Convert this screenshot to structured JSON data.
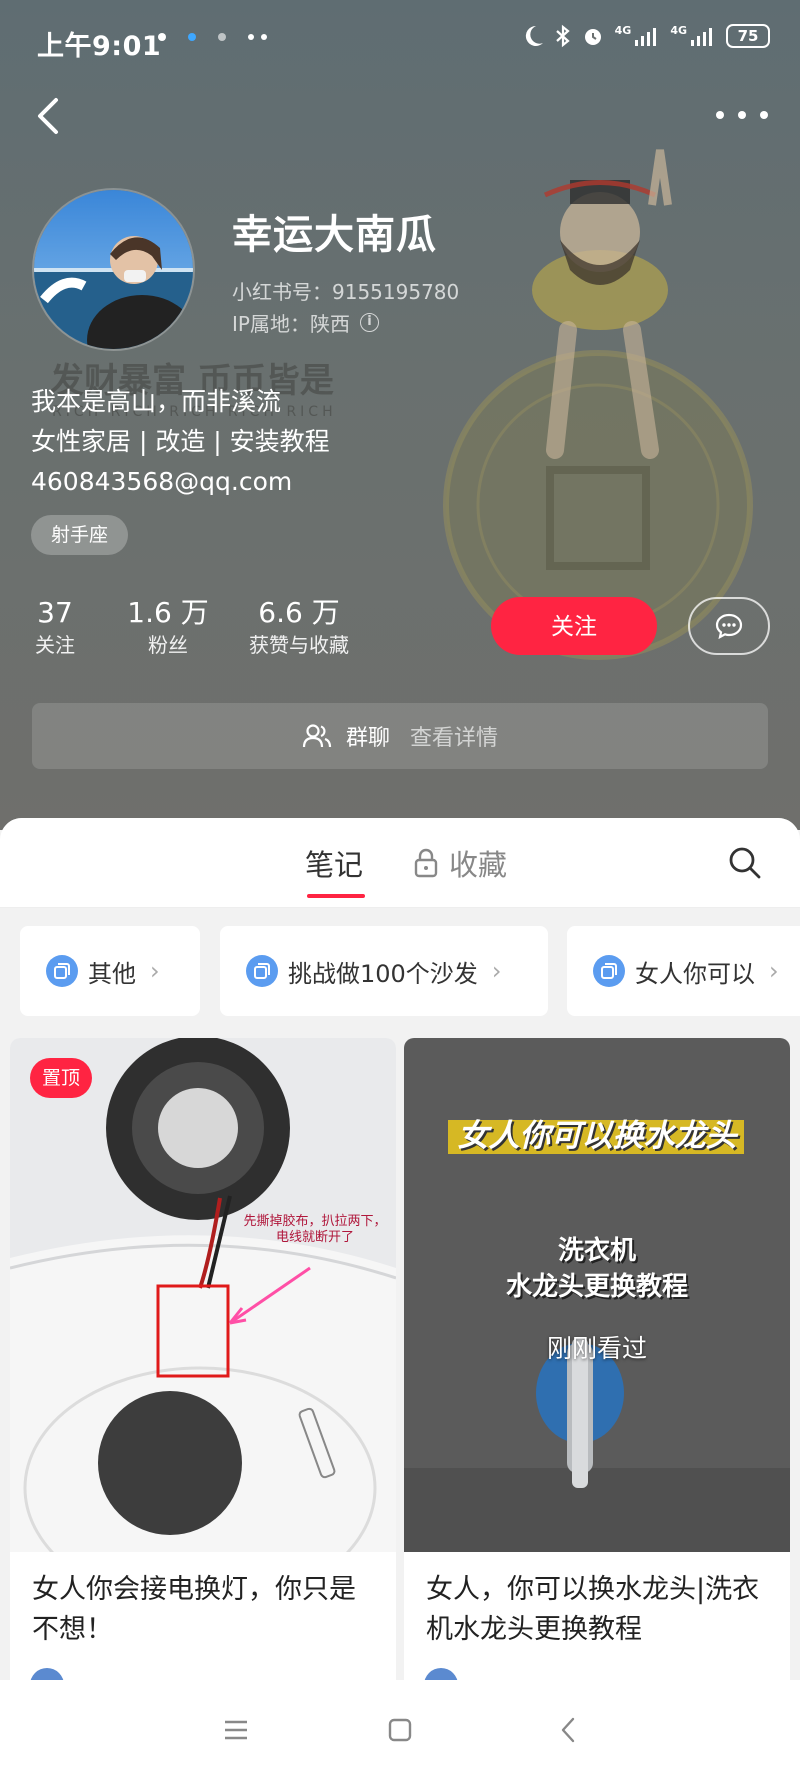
{
  "status_bar": {
    "time": "上午9:01",
    "network": "4G",
    "network2": "4G",
    "battery": "75"
  },
  "profile": {
    "nickname": "幸运大南瓜",
    "red_id": "小红书号：9155195780",
    "ip_location": "IP属地：陕西",
    "bio_lines": [
      "我本是高山，而非溪流",
      "女性家居 | 改造 | 安装教程",
      "460843568@qq.com"
    ],
    "tag": "射手座",
    "stats": [
      {
        "value": "37",
        "label": "关注"
      },
      {
        "value": "1.6 万",
        "label": "粉丝"
      },
      {
        "value": "6.6 万",
        "label": "获赞与收藏"
      }
    ],
    "follow_label": "关注",
    "group_chat_label": "群聊",
    "group_chat_detail": "查看详情",
    "background_art_text": {
      "line1": "发财暴富 币币皆是",
      "line2": "RICH RICH RICH RICH RICH"
    }
  },
  "tabs": {
    "notes": "笔记",
    "collections": "收藏",
    "active": "notes"
  },
  "collections": [
    {
      "label": "其他"
    },
    {
      "label": "挑战做100个沙发"
    },
    {
      "label": "女人你可以"
    }
  ],
  "notes": [
    {
      "title": "女人你会接电换灯，你只是不想！",
      "pinned_label": "置顶",
      "image_annotation": "先撕掉胶布，扒拉两下，电线就断开了"
    },
    {
      "title": "女人，你可以换水龙头|洗衣机水龙头更换教程",
      "image_title": "女人你可以换水龙头",
      "image_subtitle_line1": "洗衣机",
      "image_subtitle_line2": "水龙头更换教程",
      "recent_label": "刚刚看过"
    }
  ],
  "colors": {
    "accent": "#ff2442",
    "header_bg": "#656e70",
    "chip_icon": "#5b9cf0"
  },
  "icons": [
    "back-icon",
    "more-icon",
    "info-icon",
    "chat-bubble-icon",
    "group-icon",
    "lock-icon",
    "search-icon",
    "collection-icon",
    "chevron-right-icon",
    "menu-icon",
    "home-icon",
    "nav-back-icon"
  ]
}
